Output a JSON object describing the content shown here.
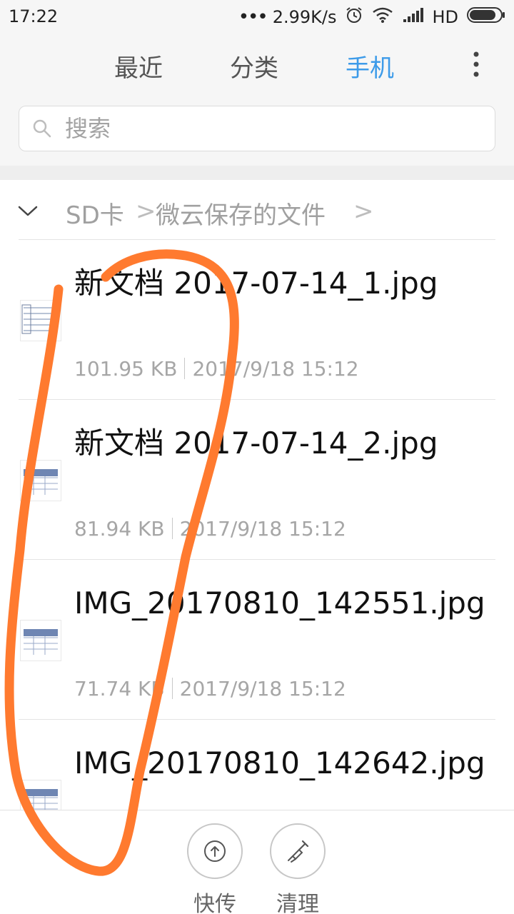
{
  "status_bar": {
    "time": "17:22",
    "dots": "•••",
    "network_speed": "2.99K/s",
    "hd": "HD",
    "icons": [
      "alarm-icon",
      "wifi-icon",
      "signal-icon",
      "battery-icon"
    ]
  },
  "tabs": {
    "recent": "最近",
    "category": "分类",
    "phone": "手机",
    "active": "phone",
    "active_color": "#3d9be9"
  },
  "search": {
    "placeholder": "搜索"
  },
  "breadcrumb": {
    "items": [
      "SD卡",
      "微云保存的文件"
    ],
    "separator": ">"
  },
  "files": [
    {
      "name": "新文档 2017-07-14_1.jpg",
      "size": "101.95 KB",
      "date": "2017/9/18 15:12"
    },
    {
      "name": "新文档 2017-07-14_2.jpg",
      "size": "81.94 KB",
      "date": "2017/9/18 15:12"
    },
    {
      "name": "IMG_20170810_142551.jpg",
      "size": "71.74 KB",
      "date": "2017/9/18 15:12"
    },
    {
      "name": "IMG_20170810_142642.jpg",
      "size": "",
      "date": ""
    }
  ],
  "bottom_tools": {
    "quicksend": "快传",
    "clean": "清理"
  },
  "annotation_color": "#ff7a2f"
}
